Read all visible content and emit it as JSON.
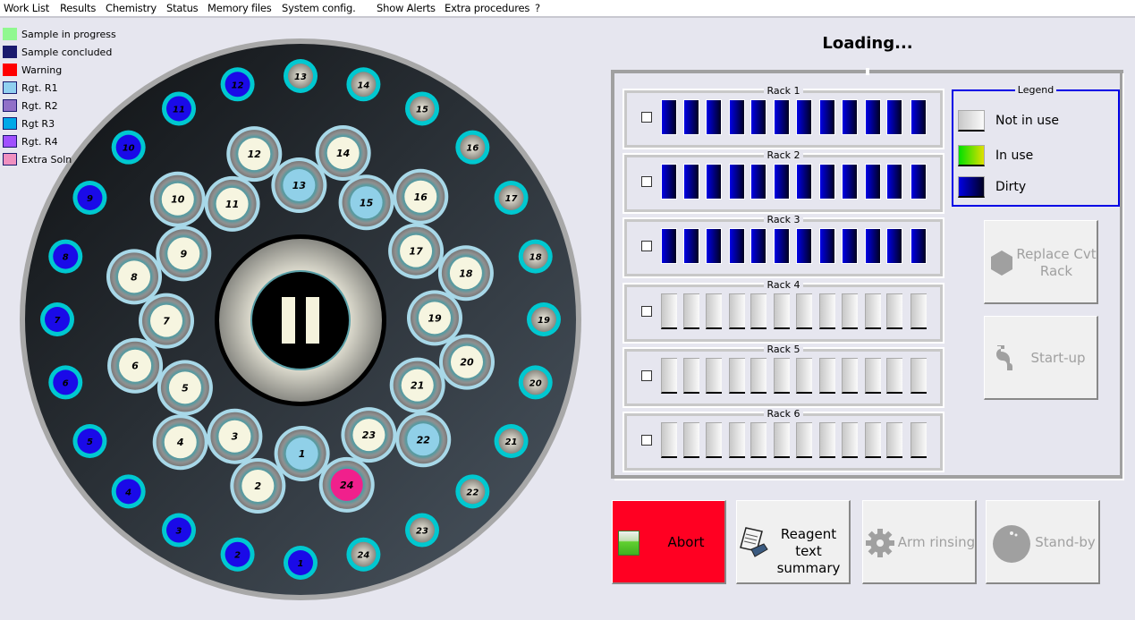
{
  "menu": [
    "Work List",
    "Results",
    "Chemistry",
    "Status",
    "Memory files",
    "System config.",
    "Show Alerts",
    "Extra procedures",
    "?"
  ],
  "status_legend": [
    {
      "label": "Sample in progress",
      "color": "#90f890"
    },
    {
      "label": "Sample concluded",
      "color": "#1a1a6e"
    },
    {
      "label": "Warning",
      "color": "#ff0000"
    },
    {
      "label": "Rgt. R1",
      "color": "#90d0f0"
    },
    {
      "label": "Rgt. R2",
      "color": "#9070c8"
    },
    {
      "label": "Rgt R3",
      "color": "#00a8e8"
    },
    {
      "label": "Rgt. R4",
      "color": "#a050ff"
    },
    {
      "label": "Extra Soln",
      "color": "#f090c0"
    }
  ],
  "carousel": {
    "state_icon": "pause-icon",
    "sample_positions": [
      {
        "n": "1",
        "state": "concluded"
      },
      {
        "n": "2",
        "state": "concluded"
      },
      {
        "n": "3",
        "state": "concluded"
      },
      {
        "n": "4",
        "state": "concluded"
      },
      {
        "n": "5",
        "state": "concluded"
      },
      {
        "n": "6",
        "state": "concluded"
      },
      {
        "n": "7",
        "state": "concluded"
      },
      {
        "n": "8",
        "state": "concluded"
      },
      {
        "n": "9",
        "state": "concluded"
      },
      {
        "n": "10",
        "state": "concluded"
      },
      {
        "n": "11",
        "state": "concluded"
      },
      {
        "n": "12",
        "state": "concluded"
      },
      {
        "n": "13",
        "state": "empty"
      },
      {
        "n": "14",
        "state": "empty"
      },
      {
        "n": "15",
        "state": "empty"
      },
      {
        "n": "16",
        "state": "empty"
      },
      {
        "n": "17",
        "state": "empty"
      },
      {
        "n": "18",
        "state": "empty"
      },
      {
        "n": "19",
        "state": "empty"
      },
      {
        "n": "20",
        "state": "empty"
      },
      {
        "n": "21",
        "state": "empty"
      },
      {
        "n": "22",
        "state": "empty"
      },
      {
        "n": "23",
        "state": "empty"
      },
      {
        "n": "24",
        "state": "empty"
      }
    ],
    "reagent_positions": [
      {
        "n": "1",
        "state": "r1"
      },
      {
        "n": "2",
        "state": "empty"
      },
      {
        "n": "3",
        "state": "empty"
      },
      {
        "n": "4",
        "state": "empty"
      },
      {
        "n": "5",
        "state": "empty"
      },
      {
        "n": "6",
        "state": "empty"
      },
      {
        "n": "7",
        "state": "empty"
      },
      {
        "n": "8",
        "state": "empty"
      },
      {
        "n": "9",
        "state": "empty"
      },
      {
        "n": "10",
        "state": "empty"
      },
      {
        "n": "11",
        "state": "empty"
      },
      {
        "n": "12",
        "state": "empty"
      },
      {
        "n": "13",
        "state": "r1"
      },
      {
        "n": "14",
        "state": "empty"
      },
      {
        "n": "15",
        "state": "r1"
      },
      {
        "n": "16",
        "state": "empty"
      },
      {
        "n": "17",
        "state": "empty"
      },
      {
        "n": "18",
        "state": "empty"
      },
      {
        "n": "19",
        "state": "empty"
      },
      {
        "n": "20",
        "state": "empty"
      },
      {
        "n": "21",
        "state": "empty"
      },
      {
        "n": "22",
        "state": "r1"
      },
      {
        "n": "23",
        "state": "empty"
      },
      {
        "n": "24",
        "state": "extra"
      }
    ]
  },
  "status_title": "Loading...",
  "racks": [
    {
      "label": "Rack 1",
      "state": "dirty",
      "checked": false
    },
    {
      "label": "Rack 2",
      "state": "dirty",
      "checked": false
    },
    {
      "label": "Rack 3",
      "state": "dirty",
      "checked": false
    },
    {
      "label": "Rack 4",
      "state": "notuse",
      "checked": false
    },
    {
      "label": "Rack 5",
      "state": "notuse",
      "checked": false
    },
    {
      "label": "Rack 6",
      "state": "notuse",
      "checked": false
    }
  ],
  "cuvettes_per_rack": 12,
  "rack_legend": {
    "title": "Legend",
    "items": [
      {
        "label": "Not in use",
        "gradient": [
          "#c8c8c8",
          "#fafafa"
        ]
      },
      {
        "label": "In use",
        "gradient": [
          "#00e000",
          "#e0e000"
        ]
      },
      {
        "label": "Dirty",
        "gradient": [
          "#0000e6",
          "#000020"
        ]
      }
    ]
  },
  "buttons": {
    "replace_rack": "Replace Cvt Rack",
    "startup": "Start-up",
    "abort": "Abort",
    "reagent_summary": "Reagent text summary",
    "arm_rinsing": "Arm rinsing",
    "standby": "Stand-by"
  }
}
